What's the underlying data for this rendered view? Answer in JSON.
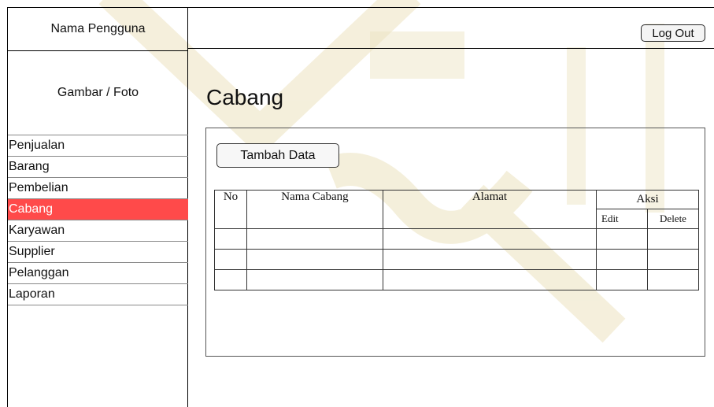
{
  "sidebar": {
    "user_name": "Nama Pengguna",
    "avatar_placeholder": "Gambar / Foto",
    "menu": [
      {
        "label": "Penjualan"
      },
      {
        "label": "Barang"
      },
      {
        "label": "Pembelian"
      },
      {
        "label": "Cabang"
      },
      {
        "label": "Karyawan"
      },
      {
        "label": "Supplier"
      },
      {
        "label": "Pelanggan"
      },
      {
        "label": "Laporan"
      }
    ],
    "active_item": "Cabang"
  },
  "header": {
    "logout_label": "Log Out"
  },
  "main": {
    "title": "Cabang",
    "add_button_label": "Tambah Data",
    "table": {
      "columns": [
        "No",
        "Nama Cabang",
        "Alamat",
        "Aksi"
      ],
      "action_subcolumns": [
        "Edit",
        "Delete"
      ],
      "rows": [
        [
          "",
          "",
          "",
          "",
          ""
        ],
        [
          "",
          "",
          "",
          "",
          ""
        ],
        [
          "",
          "",
          "",
          "",
          ""
        ]
      ]
    }
  },
  "colors": {
    "active_menu_bg": "#ff4a4a",
    "watermark": "#e8d9a8"
  }
}
